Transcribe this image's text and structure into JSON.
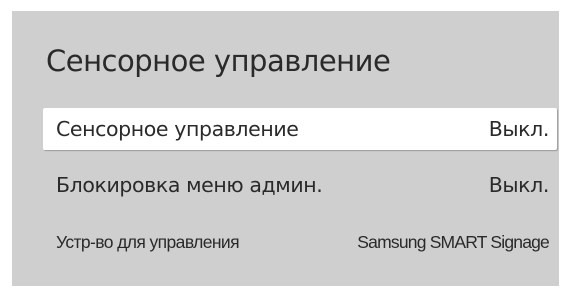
{
  "menu": {
    "title": "Сенсорное управление",
    "items": [
      {
        "label": "Сенсорное управление",
        "value": "Выкл."
      },
      {
        "label": "Блокировка меню админ.",
        "value": "Выкл."
      },
      {
        "label": "Устр-во для управления",
        "value": "Samsung SMART Signage"
      }
    ]
  },
  "colors": {
    "panel_background": "#cfcfcf",
    "selected_background": "#ffffff",
    "text": "#2a2a2a"
  }
}
